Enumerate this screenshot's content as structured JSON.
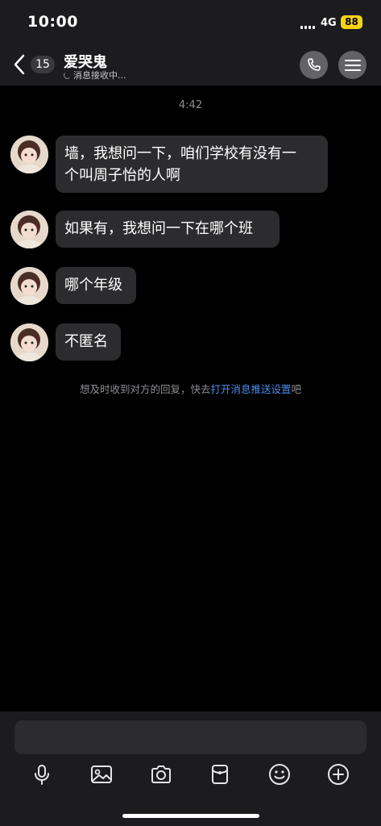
{
  "status": {
    "time": "10:00",
    "network": "4G",
    "battery": "88"
  },
  "header": {
    "unread_count": "15",
    "title": "爱哭鬼",
    "subtitle": "消息接收中..."
  },
  "chat": {
    "timestamp": "4:42",
    "messages": [
      {
        "line1": "墙，我想问一下，咱们学校有没有一",
        "line2": "个叫周子怡的人啊"
      },
      {
        "text": "如果有，我想问一下在哪个班"
      },
      {
        "text": "哪个年级"
      },
      {
        "text": "不匿名"
      }
    ],
    "notice": {
      "prefix": "想及时收到对方的回复，快去",
      "link": "打开消息推送设置",
      "suffix": "吧"
    }
  },
  "toolbar": {
    "icons": [
      "microphone-icon",
      "image-icon",
      "camera-icon",
      "red-packet-icon",
      "emoji-icon",
      "add-icon"
    ]
  },
  "colors": {
    "background": "#000000",
    "bar": "#1c1c1e",
    "bubble": "#2c2c2e",
    "link": "#4a8ef0",
    "battery": "#f5d40f"
  }
}
